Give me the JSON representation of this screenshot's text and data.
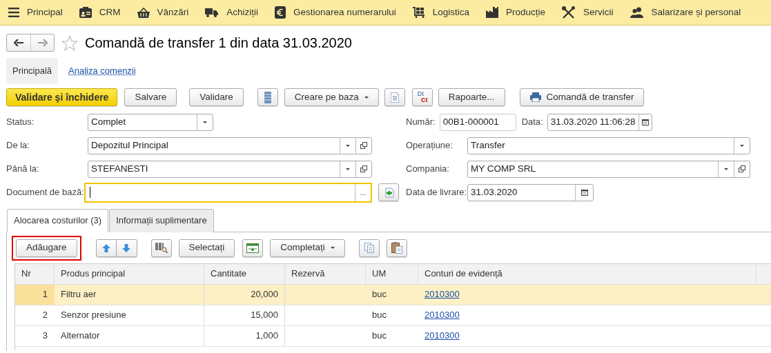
{
  "menu": [
    {
      "label": "Principal"
    },
    {
      "label": "CRM"
    },
    {
      "label": "Vânzări"
    },
    {
      "label": "Achiziții"
    },
    {
      "label": "Gestionarea numerarului"
    },
    {
      "label": "Logistica"
    },
    {
      "label": "Producție"
    },
    {
      "label": "Servicii"
    },
    {
      "label": "Salarizare și personal"
    }
  ],
  "title": "Comandă de transfer 1 din data 31.03.2020",
  "favorite": false,
  "sections": [
    {
      "label": "Principală",
      "selected": true
    },
    {
      "label": "Analiza comenzii",
      "selected": false
    }
  ],
  "toolbar": [
    {
      "kind": "primary",
      "label": "Validare şi închidere"
    },
    {
      "kind": "button",
      "label": "Salvare"
    },
    {
      "kind": "button",
      "label": "Validare"
    },
    {
      "kind": "icon"
    },
    {
      "kind": "dropdown",
      "label": "Creare pe baza"
    },
    {
      "kind": "icon"
    },
    {
      "kind": "dtct",
      "top": "Dt",
      "bottom": "Ct"
    },
    {
      "kind": "button",
      "label": "Rapoarte..."
    },
    {
      "kind": "print",
      "label": "Comandă de transfer"
    }
  ],
  "left_fields": [
    {
      "label": "Status:",
      "value": "Complet",
      "kind": "combo"
    },
    {
      "label": "De la:",
      "value": "Depozitul Principal",
      "kind": "combo-open"
    },
    {
      "label": "Până la:",
      "value": "STEFANESTI",
      "kind": "combo-open"
    },
    {
      "label": "Document de bază:",
      "kind": "choice",
      "button_text": "...",
      "focused": true
    }
  ],
  "right_fields": [
    [
      {
        "label": "Număr:",
        "value": "00B1-000001",
        "kind": "text"
      },
      {
        "label": "Data:",
        "value": "31.03.2020 11:06:28",
        "kind": "date"
      }
    ],
    [
      {
        "label": "Operațiune:",
        "value": "Transfer",
        "kind": "combo"
      }
    ],
    [
      {
        "label": "Compania:",
        "value": "MY COMP SRL",
        "kind": "combo-open"
      }
    ],
    [
      {
        "label": "Data de livrare:",
        "value": "31.03.2020",
        "kind": "date"
      }
    ]
  ],
  "tabs": [
    {
      "label": "Alocarea costurilor (3)",
      "selected": true
    },
    {
      "label": "Informații suplimentare",
      "selected": false
    }
  ],
  "table_toolbar": [
    {
      "kind": "button",
      "label": "Adăugare",
      "highlighted": true
    },
    {
      "kind": "updown"
    },
    {
      "kind": "icon"
    },
    {
      "kind": "button",
      "label": "Selectați"
    },
    {
      "kind": "icon"
    },
    {
      "kind": "dropdown",
      "label": "Completați"
    },
    {
      "kind": "icon"
    },
    {
      "kind": "icon"
    }
  ],
  "table": {
    "columns": [
      "Nr",
      "Produs principal",
      "Cantitate",
      "Rezervă",
      "UM",
      "Conturi de evidență"
    ],
    "rows": [
      {
        "nr": "1",
        "product": "Filtru aer",
        "quantity": "20,000",
        "unit": "buc",
        "account": "2010300",
        "selected": true
      },
      {
        "nr": "2",
        "product": "Senzor presiune",
        "quantity": "15,000",
        "unit": "buc",
        "account": "2010300",
        "selected": false
      },
      {
        "nr": "3",
        "product": "Alternator",
        "quantity": "1,000",
        "unit": "buc",
        "account": "2010300",
        "selected": false
      }
    ]
  }
}
